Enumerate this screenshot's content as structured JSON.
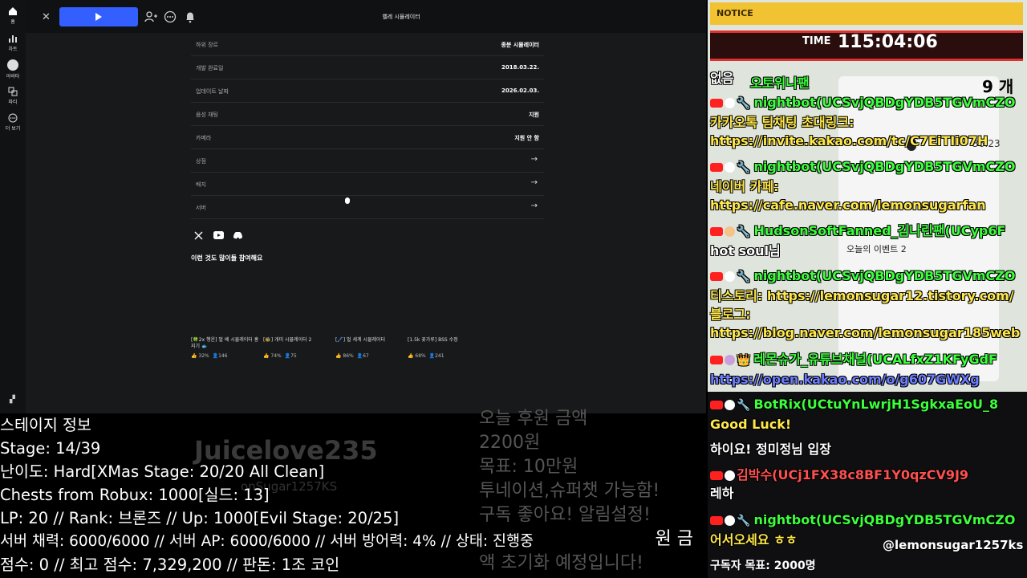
{
  "sidebar": {
    "items": [
      {
        "label": "홈",
        "icon": "home-icon"
      },
      {
        "label": "차트",
        "icon": "chart-icon"
      },
      {
        "label": "아바타",
        "icon": "avatar-icon"
      },
      {
        "label": "파티",
        "icon": "party-icon"
      },
      {
        "label": "더 보기",
        "icon": "more-icon"
      }
    ]
  },
  "game": {
    "title": "벨레 시뮬레이터",
    "info": [
      {
        "label": "하위 장르",
        "value": "종분 시뮬레이터"
      },
      {
        "label": "개발 완료일",
        "value": "2018.03.22."
      },
      {
        "label": "업데이트 날짜",
        "value": "2026.02.03."
      },
      {
        "label": "음성 채팅",
        "value": "지원"
      },
      {
        "label": "카메라",
        "value": "지원 안 함"
      }
    ],
    "links": [
      {
        "label": "상점",
        "arrow": "→"
      },
      {
        "label": "배지",
        "arrow": "→"
      },
      {
        "label": "서버",
        "arrow": "→"
      }
    ],
    "more_title": "이런 것도 많이들 참여해요",
    "recommendations": [
      {
        "title": "[🍀2x 행운] 벌 쎄 시뮬레이터 홍지기 🐟",
        "like": "32%",
        "players": "146"
      },
      {
        "title": "[🐝] 개미 시뮬레이터 2",
        "like": "74%",
        "players": "75"
      },
      {
        "title": "[🖊️] 벌 세계 시뮬레이터",
        "like": "86%",
        "players": "67"
      },
      {
        "title": "[1.5k 꽃가루] BSS 수정",
        "like": "68%",
        "players": "241"
      }
    ]
  },
  "stage_info": {
    "lines": [
      "스테이지 정보",
      "Stage: 14/39",
      "난이도: Hard[XMas Stage: 20/20 All Clean]",
      "Chests from Robux: 1000[실드: 13]",
      "LP: 20 // Rank: 브론즈 // Up: 1000[Evil Stage: 20/25]",
      "서버 채력: 6000/6000 // 서버 AP: 6000/6000 // 서버 방어력: 4% // 상태: 진행중",
      "점수: 0 // 최고 점수: 7,329,200 // 판돈: 1조 코인"
    ],
    "watermark": "Juicelove235",
    "watermark_sub": "onSugar1257KS"
  },
  "donation": {
    "lines": [
      "오늘 후원 금액",
      "2200원",
      "목표: 10만원",
      "투네이션,슈퍼챗 가능함!",
      "구독 좋아요! 알림설정!",
      "원 금",
      "액 초기화 예정입니다!"
    ]
  },
  "chat": {
    "notice": "NOTICE",
    "timer_label": "TIME",
    "timer_value": "115:04:06",
    "right_number": "9 개",
    "chat_time": "36:23",
    "event_text": "오늘의 이벤트 2",
    "messages": [
      {
        "name": "",
        "text": "없음"
      },
      {
        "name": "오토위니팬",
        "text": ""
      },
      {
        "name": "nightbot(UCSvjQBDgYDB5TGVmCZO",
        "text": "카카오톡 팀채팅 초대링크: https://invite.kakao.com/tc/C7EiTIi07H"
      },
      {
        "name": "nightbot(UCSvjQBDgYDB5TGVmCZO",
        "text": "네이버 카페: https://cafe.naver.com/lemonsugarfan"
      },
      {
        "name": "HudsonSoftFanned_김나린팬(UCyp6F",
        "text": "hot soul님"
      },
      {
        "name": "nightbot(UCSvjQBDgYDB5TGVmCZO",
        "text": "티스토리: https://lemonsugar12.tistory.com/ 블로그: https://blog.naver.com/lemonsugar185web"
      },
      {
        "name": "레몬슈가_유튜브채널(UCALfxZ1KFyGdF",
        "text": "https://open.kakao.com/o/g607GWXg"
      },
      {
        "name": "BotRix(UCtuYnLwrjH1SgkxaEoU_8",
        "text": "Good Luck!"
      },
      {
        "name": "",
        "text": "하이요! 정미정님 입장"
      },
      {
        "name": "김박수(UCj1FX38c8BF1Y0qzCV9J9",
        "text": "레하"
      },
      {
        "name": "nightbot(UCSvjQBDgYDB5TGVmCZO",
        "text": "어서오세요 ㅎㅎ"
      }
    ],
    "bottom_at": "@lemonsugar1257ks",
    "bottom_text": "구독자 목표: 2000명"
  }
}
